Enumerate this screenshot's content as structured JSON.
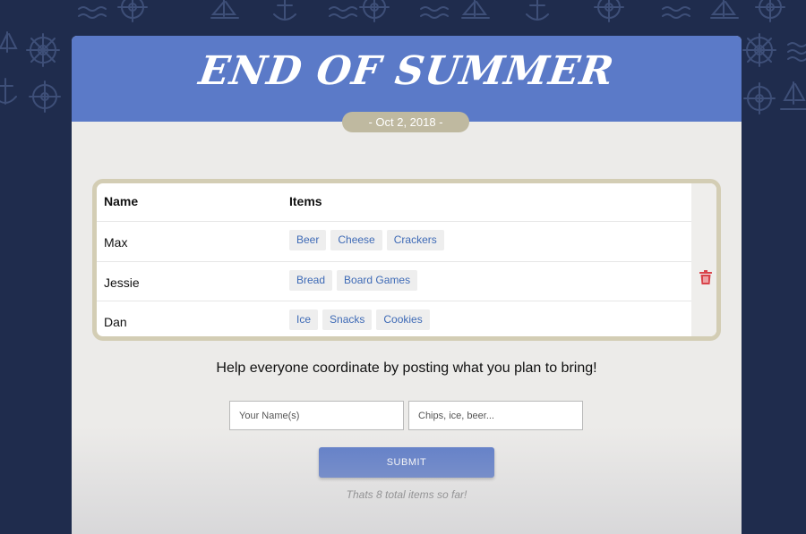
{
  "header": {
    "title": "End of summer",
    "date": "- Oct 2, 2018 -"
  },
  "table": {
    "columns": [
      "Name",
      "Items"
    ],
    "rows": [
      {
        "name": "Max",
        "items": [
          "Beer",
          "Cheese",
          "Crackers"
        ]
      },
      {
        "name": "Jessie",
        "items": [
          "Bread",
          "Board Games"
        ]
      },
      {
        "name": "Dan",
        "items": [
          "Ice",
          "Snacks",
          "Cookies"
        ]
      }
    ]
  },
  "help_text": "Help everyone coordinate by posting what you plan to bring!",
  "form": {
    "name_placeholder": "Your Name(s)",
    "items_placeholder": "Chips, ice, beer...",
    "submit_label": "SUBMIT"
  },
  "total_text": "Thats 8 total items so far!",
  "icons": {
    "delete": "trash-icon",
    "background": "nautical-pattern"
  },
  "colors": {
    "banner": "#5b7ac8",
    "page_background": "#1f2c4d",
    "card": "#ecebe9",
    "tag_text": "#3e6ab6",
    "delete_icon": "#d9434a",
    "date_pill": "#bfb9a0"
  }
}
